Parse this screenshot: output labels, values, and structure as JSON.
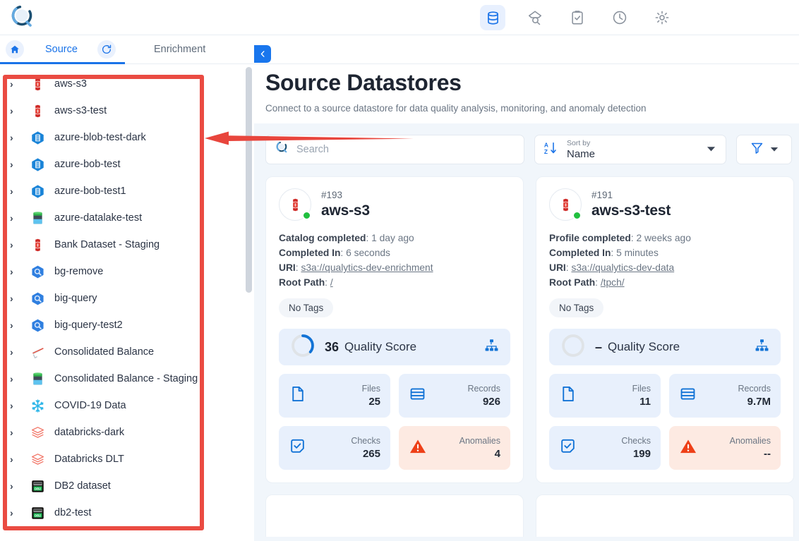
{
  "app": {
    "logo_icon": "qualytics-magnifier-logo"
  },
  "topnav": {
    "items": [
      {
        "name": "datastores",
        "icon": "database-icon",
        "active": true
      },
      {
        "name": "explore",
        "icon": "search-diamond-icon",
        "active": false
      },
      {
        "name": "checks",
        "icon": "clipboard-check-icon",
        "active": false
      },
      {
        "name": "history",
        "icon": "clock-icon",
        "active": false
      },
      {
        "name": "settings",
        "icon": "gear-icon",
        "active": false
      }
    ]
  },
  "tabstrip": {
    "home_icon": "home-icon",
    "source_tab": "Source",
    "refresh_icon": "refresh-icon",
    "enrichment_tab": "Enrichment",
    "collapse_icon": "chevron-left-icon"
  },
  "sidebar": {
    "items": [
      {
        "label": "aws-s3",
        "icon": "aws-s3-icon"
      },
      {
        "label": "aws-s3-test",
        "icon": "aws-s3-icon"
      },
      {
        "label": "azure-blob-test-dark",
        "icon": "azure-blob-icon"
      },
      {
        "label": "azure-bob-test",
        "icon": "azure-blob-icon"
      },
      {
        "label": "azure-bob-test1",
        "icon": "azure-blob-icon"
      },
      {
        "label": "azure-datalake-test",
        "icon": "azure-datalake-icon"
      },
      {
        "label": "Bank Dataset - Staging",
        "icon": "aws-s3-icon"
      },
      {
        "label": "bg-remove",
        "icon": "bigquery-icon"
      },
      {
        "label": "big-query",
        "icon": "bigquery-icon"
      },
      {
        "label": "big-query-test2",
        "icon": "bigquery-icon"
      },
      {
        "label": "Consolidated Balance",
        "icon": "athena-icon"
      },
      {
        "label": "Consolidated Balance - Staging",
        "icon": "azure-datalake-icon"
      },
      {
        "label": "COVID-19 Data",
        "icon": "snowflake-icon"
      },
      {
        "label": "databricks-dark",
        "icon": "databricks-icon"
      },
      {
        "label": "Databricks DLT",
        "icon": "databricks-icon"
      },
      {
        "label": "DB2 dataset",
        "icon": "db2-icon"
      },
      {
        "label": "db2-test",
        "icon": "db2-icon"
      }
    ]
  },
  "page": {
    "title": "Source Datastores",
    "subtitle": "Connect to a source datastore for data quality analysis, monitoring, and anomaly detection"
  },
  "toolbar": {
    "search_placeholder": "Search",
    "search_value": "",
    "search_icon": "search-logo-icon",
    "sort_caption": "Sort by",
    "sort_value": "Name",
    "sort_icon": "sort-az-icon",
    "filter_icon": "filter-funnel-icon"
  },
  "cards": [
    {
      "id": "#193",
      "name": "aws-s3",
      "icon": "aws-s3-icon",
      "status": "online",
      "status_color": "#20bf3f",
      "meta": [
        {
          "label": "Catalog completed",
          "value": "1 day ago",
          "link": false
        },
        {
          "label": "Completed In",
          "value": "6 seconds",
          "link": false
        },
        {
          "label": "URI",
          "value": "s3a://qualytics-dev-enrichment",
          "link": true
        },
        {
          "label": "Root Path",
          "value": "/",
          "link": true
        }
      ],
      "tag": "No Tags",
      "quality_score": "36",
      "quality_percent": 36,
      "quality_label": "Quality Score",
      "tree_icon": "hierarchy-icon",
      "stats": [
        {
          "label": "Files",
          "value": "25",
          "icon": "file-icon",
          "warn": false
        },
        {
          "label": "Records",
          "value": "926",
          "icon": "records-icon",
          "warn": false
        },
        {
          "label": "Checks",
          "value": "265",
          "icon": "check-square-icon",
          "warn": false
        },
        {
          "label": "Anomalies",
          "value": "4",
          "icon": "warning-triangle-icon",
          "warn": true
        }
      ]
    },
    {
      "id": "#191",
      "name": "aws-s3-test",
      "icon": "aws-s3-icon",
      "status": "online",
      "status_color": "#20bf3f",
      "meta": [
        {
          "label": "Profile completed",
          "value": "2 weeks ago",
          "link": false
        },
        {
          "label": "Completed In",
          "value": "5 minutes",
          "link": false
        },
        {
          "label": "URI",
          "value": "s3a://qualytics-dev-data",
          "link": true
        },
        {
          "label": "Root Path",
          "value": "/tpch/",
          "link": true
        }
      ],
      "tag": "No Tags",
      "quality_score": "–",
      "quality_percent": 0,
      "quality_label": "Quality Score",
      "tree_icon": "hierarchy-icon",
      "stats": [
        {
          "label": "Files",
          "value": "11",
          "icon": "file-icon",
          "warn": false
        },
        {
          "label": "Records",
          "value": "9.7M",
          "icon": "records-icon",
          "warn": false
        },
        {
          "label": "Checks",
          "value": "199",
          "icon": "check-square-icon",
          "warn": false
        },
        {
          "label": "Anomalies",
          "value": "--",
          "icon": "warning-triangle-icon",
          "warn": true
        }
      ]
    }
  ],
  "annotation": {
    "box_color": "#ea4b42",
    "arrow_color": "#e8453c",
    "arrow_icon": "left-arrow-annotation"
  },
  "colors": {
    "accent": "#1a73e8",
    "panel_bg": "#f1f6fb",
    "stat_bg": "#e8f0fc",
    "warn_bg": "#fdeae2",
    "warn_fg": "#ee4018"
  }
}
